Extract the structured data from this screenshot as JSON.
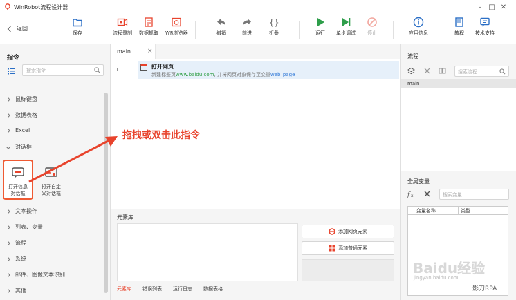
{
  "window": {
    "title": "WinRobot流程设计器",
    "controls": [
      "minimize-icon",
      "maximize-icon",
      "close-icon"
    ]
  },
  "toolbar": {
    "back_label": "返回",
    "save_label": "保存",
    "record_label": "流程录制",
    "capture_label": "数据抓取",
    "browser_label": "WR浏览器",
    "undo_label": "撤销",
    "redo_label": "前进",
    "fold_label": "折叠",
    "run_label": "运行",
    "step_label": "单步调试",
    "stop_label": "停止",
    "appinfo_label": "应用信息",
    "tutorial_label": "教程",
    "support_label": "技术支持"
  },
  "left": {
    "title": "指令",
    "search_placeholder": "搜索指令",
    "categories": [
      "鼠标键盘",
      "数据表格",
      "Excel",
      "对话框",
      "文本操作",
      "列表、变量",
      "流程",
      "系统",
      "邮件、图像文本识别",
      "其他"
    ],
    "commands": [
      "打开信息对话框",
      "打开自定义对话框"
    ]
  },
  "editor": {
    "tab": "main",
    "line_number": "1",
    "step_title": "打开网页",
    "step_desc_prefix": "新建标签页",
    "step_desc_url": "www.baidu.com",
    "step_desc_mid": ", 并将网页对象保存至变量",
    "step_desc_var": "web_page"
  },
  "annotation": "拖拽或双击此指令",
  "elements": {
    "title": "元素库",
    "add_web_label": "添加网页元素",
    "add_normal_label": "添加普通元素",
    "tabs": [
      "元素库",
      "错误列表",
      "运行日志",
      "数据表格"
    ]
  },
  "right": {
    "flow_title": "流程",
    "flow_search_placeholder": "搜索流程",
    "flow_item": "main",
    "var_title": "全局变量",
    "var_search_placeholder": "搜索变量",
    "var_col_name": "变量名称",
    "var_col_type": "类型"
  },
  "watermark": {
    "main": "Baidu经验",
    "sub": "jingyan.baidu.com",
    "tag": "影刀RPA"
  },
  "colors": {
    "accent": "#e8432c",
    "link": "#2f9e44",
    "var": "#2b75d6",
    "selection": "#e6f0fa"
  }
}
